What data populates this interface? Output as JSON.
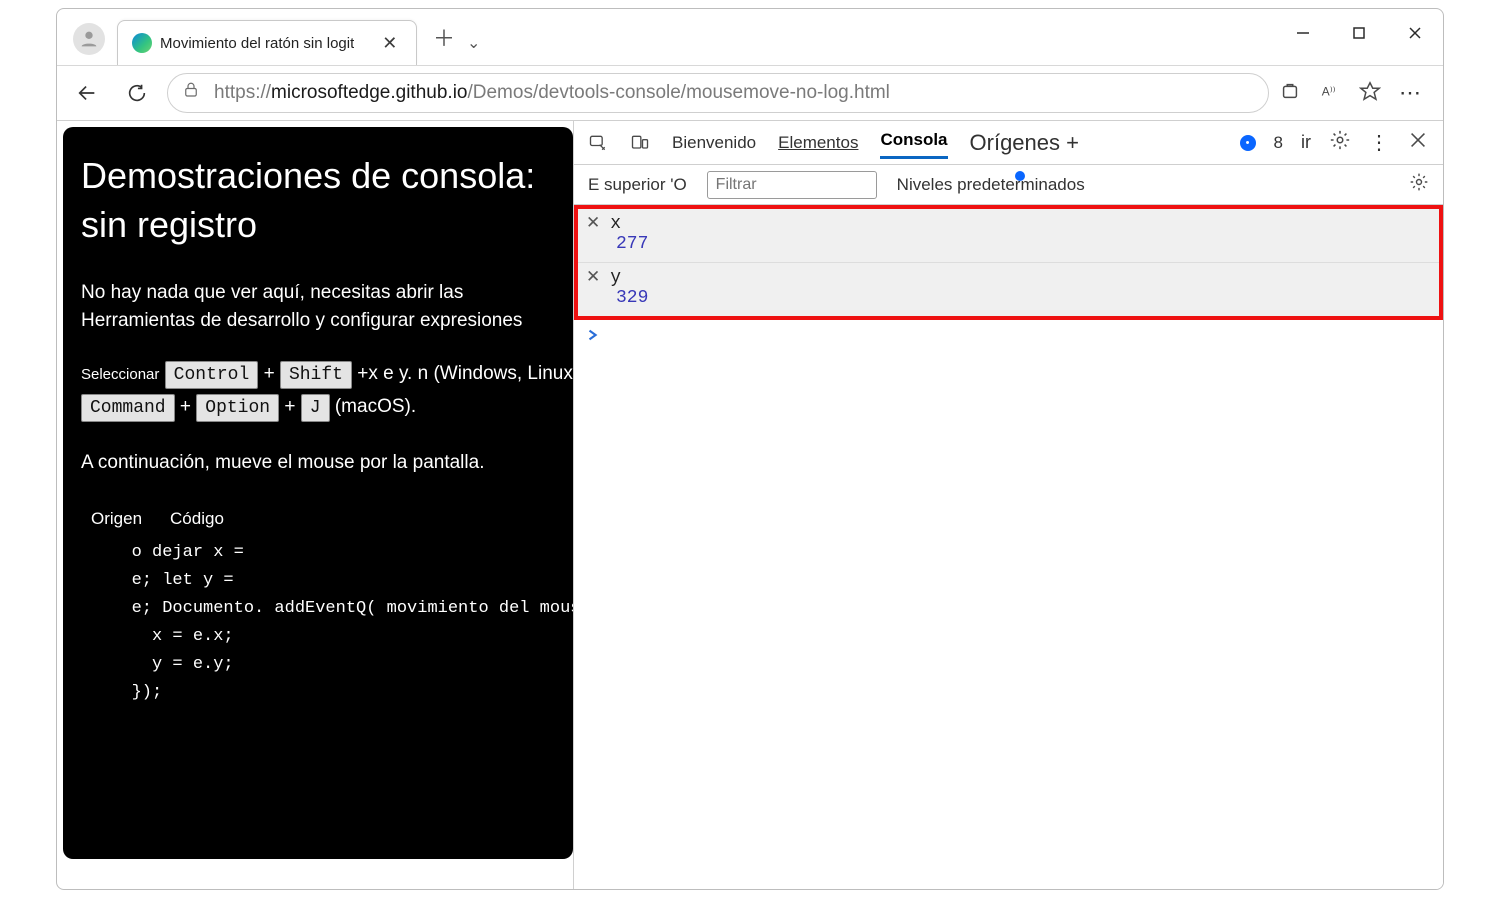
{
  "browser": {
    "tab_title": "Movimiento del ratón sin logit",
    "url_host": "microsoftedge.github.io",
    "url_rest": "/Demos/devtools-console/mousemove-no-log.html",
    "url_scheme": "https://"
  },
  "page": {
    "heading_l1": "Demostraciones de consola:",
    "heading_l2": "sin registro",
    "intro_l1": "No hay nada que ver aquí, necesitas abrir las",
    "intro_l2": "Herramientas de desarrollo y configurar expresiones",
    "sel_label": "Seleccionar",
    "kb_ctrl": "Control",
    "kb_shift": "Shift",
    "kb_tail_win": "x e y. n (Windows, Linux)",
    "kb_cmd": "Command",
    "kb_opt": "Option",
    "kb_j": "J",
    "kb_tail_mac": "(macOS).",
    "after": "A continuación, mueve el mouse por la pantalla.",
    "code_tabs": {
      "origen": "Origen",
      "codigo": "Código"
    },
    "code": "   o dejar x =\n   e; let y =\n   e; Documento. addEventQ( movimiento del mouse '    ,  e  => {\n     x = e.x;\n     y = e.y;\n   });"
  },
  "devtools": {
    "tabs": {
      "welcome": "Bienvenido",
      "elements": "Elementos",
      "console": "Consola",
      "sources": "Orígenes",
      "more": "+"
    },
    "issues_count": "8",
    "ir": "ir",
    "filterbar": {
      "top_context": "E superior 'O",
      "filter_placeholder": "Filtrar",
      "levels": "Niveles predeterminados"
    },
    "live_expressions": [
      {
        "name": "x",
        "value": "277"
      },
      {
        "name": "y",
        "value": "329"
      }
    ]
  }
}
